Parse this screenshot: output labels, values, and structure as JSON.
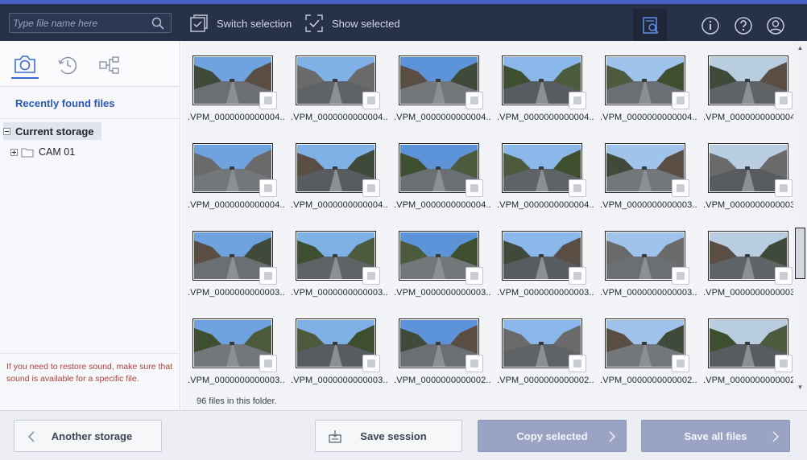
{
  "topbar": {
    "search_placeholder": "Type file name here",
    "switch_selection": "Switch selection",
    "show_selected": "Show selected"
  },
  "sidebar": {
    "recently_found": "Recently found files",
    "tree_current": "Current storage",
    "tree_folder": "CAM 01",
    "hint": "If you need to restore sound, make sure that sound is available for a specific file."
  },
  "files": [
    {
      "name": ".VPM_0000000000004..."
    },
    {
      "name": ".VPM_0000000000004..."
    },
    {
      "name": ".VPM_0000000000004..."
    },
    {
      "name": ".VPM_0000000000004..."
    },
    {
      "name": ".VPM_0000000000004..."
    },
    {
      "name": ".VPM_0000000000004..."
    },
    {
      "name": ".VPM_0000000000004..."
    },
    {
      "name": ".VPM_0000000000004..."
    },
    {
      "name": ".VPM_0000000000004..."
    },
    {
      "name": ".VPM_0000000000004..."
    },
    {
      "name": ".VPM_0000000000003..."
    },
    {
      "name": ".VPM_0000000000003..."
    },
    {
      "name": ".VPM_0000000000003..."
    },
    {
      "name": ".VPM_0000000000003..."
    },
    {
      "name": ".VPM_0000000000003..."
    },
    {
      "name": ".VPM_0000000000003..."
    },
    {
      "name": ".VPM_0000000000003..."
    },
    {
      "name": ".VPM_0000000000003..."
    },
    {
      "name": ".VPM_0000000000003..."
    },
    {
      "name": ".VPM_0000000000003..."
    },
    {
      "name": ".VPM_0000000000002..."
    },
    {
      "name": ".VPM_0000000000002..."
    },
    {
      "name": ".VPM_0000000000002..."
    },
    {
      "name": ".VPM_0000000000002..."
    }
  ],
  "status": "96 files in this folder.",
  "buttons": {
    "another_storage": "Another storage",
    "save_session": "Save session",
    "copy_selected": "Copy selected",
    "save_all": "Save all files"
  },
  "colors": {
    "topbar": "#27314a",
    "accent": "#4a5fc7",
    "link": "#2a56b5",
    "hint": "#b0403a",
    "primary_button": "#9aa3c4"
  }
}
